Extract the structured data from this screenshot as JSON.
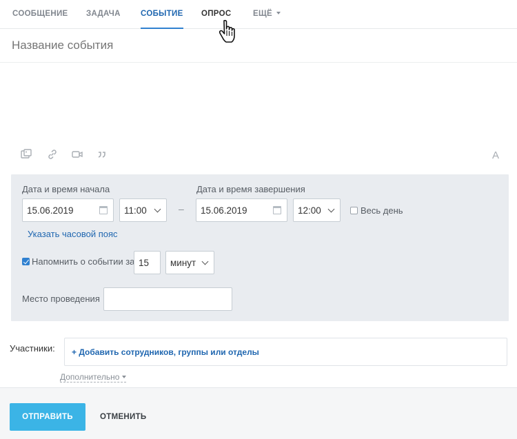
{
  "tabs": [
    {
      "label": "Сообщение"
    },
    {
      "label": "Задача"
    },
    {
      "label": "Событие"
    },
    {
      "label": "Опрос"
    },
    {
      "label": "Ещё"
    }
  ],
  "event": {
    "title_placeholder": "Название события"
  },
  "toolbar": {
    "icons": [
      "image-icon",
      "link-icon",
      "video-icon",
      "quote-icon"
    ],
    "font_label": "A"
  },
  "schedule": {
    "start_label": "Дата и время начала",
    "start_date": "15.06.2019",
    "start_time": "11:00",
    "dash": "–",
    "end_label": "Дата и время завершения",
    "end_date": "15.06.2019",
    "end_time": "12:00",
    "all_day_label": "Весь день",
    "all_day_checked": false,
    "timezone_link": "Указать часовой пояс",
    "remind_label": "Напомнить о событии за",
    "remind_checked": true,
    "remind_value": "15",
    "remind_unit": "минут",
    "location_label": "Место проведения",
    "location_value": ""
  },
  "participants": {
    "label": "Участники:",
    "add_link": "+ Добавить сотрудников, группы или отделы",
    "more_link": "Дополнительно"
  },
  "footer": {
    "send_label": "Отправить",
    "cancel_label": "Отменить"
  },
  "colors": {
    "accent": "#2067b0",
    "send_button": "#3bb4e6",
    "panel": "#e9ecf0"
  }
}
